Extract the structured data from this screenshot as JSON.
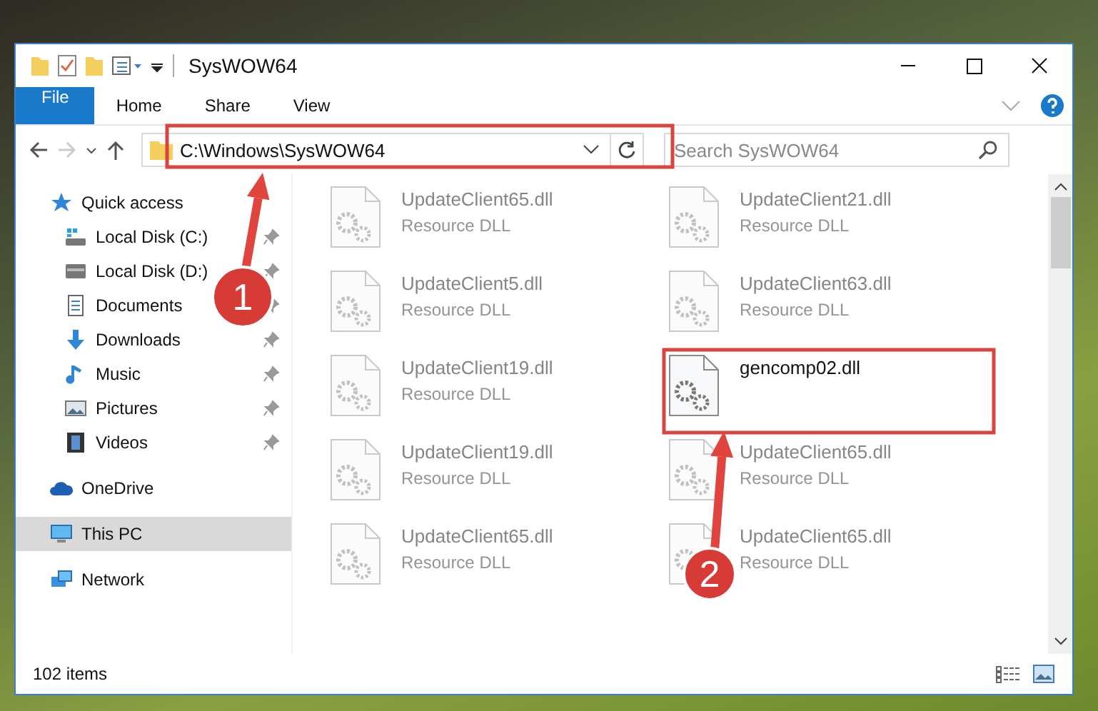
{
  "window": {
    "title": "SysWOW64"
  },
  "ribbon": {
    "tabs": [
      {
        "label": "File",
        "kind": "file",
        "selected": false
      },
      {
        "label": "Home",
        "kind": "tab",
        "selected": false
      },
      {
        "label": "Share",
        "kind": "tab",
        "selected": false
      },
      {
        "label": "View",
        "kind": "tab",
        "selected": false
      }
    ]
  },
  "nav": {
    "forward_disabled": true,
    "address": "C:\\Windows\\SysWOW64",
    "search": {
      "placeholder": "Search SysWOW64"
    }
  },
  "sidebar": {
    "items": [
      {
        "label": "Quick access",
        "selected": false,
        "children": [
          {
            "label": "Local Disk (C:)",
            "pinned": true,
            "selected": false
          },
          {
            "label": "Local Disk (D:)",
            "pinned": true,
            "selected": false
          },
          {
            "label": "Documents",
            "pinned": true,
            "selected": false
          },
          {
            "label": "Downloads",
            "pinned": true,
            "selected": false
          },
          {
            "label": "Music",
            "pinned": true,
            "selected": false
          },
          {
            "label": "Pictures",
            "pinned": true,
            "selected": false
          },
          {
            "label": "Videos",
            "pinned": true,
            "selected": false
          }
        ]
      },
      {
        "label": "OneDrive",
        "selected": false
      },
      {
        "label": "This PC",
        "selected": true
      },
      {
        "label": "Network",
        "selected": false
      }
    ]
  },
  "files": [
    {
      "name": "UpdateClient65.dll",
      "type": "Resource DLL",
      "blurred": true
    },
    {
      "name": "UpdateClient21.dll",
      "type": "Resource DLL",
      "blurred": true
    },
    {
      "name": "UpdateClient5.dll",
      "type": "Resource DLL",
      "blurred": true
    },
    {
      "name": "UpdateClient63.dll",
      "type": "Resource DLL",
      "blurred": true
    },
    {
      "name": "UpdateClient19.dll",
      "type": "Resource DLL",
      "blurred": true
    },
    {
      "name": "gencomp02.dll",
      "blurred": false
    },
    {
      "name": "UpdateClient19.dll",
      "type": "Resource DLL",
      "blurred": true
    },
    {
      "name": "UpdateClient65.dll",
      "type": "Resource DLL",
      "blurred": true
    },
    {
      "name": "UpdateClient65.dll",
      "type": "Resource DLL",
      "blurred": true
    },
    {
      "name": "UpdateClient65.dll",
      "type": "Resource DLL",
      "blurred": true
    }
  ],
  "status_bar": {
    "item_count": "102 items"
  },
  "annotations": [
    {
      "label": "1"
    },
    {
      "label": "2"
    }
  ]
}
